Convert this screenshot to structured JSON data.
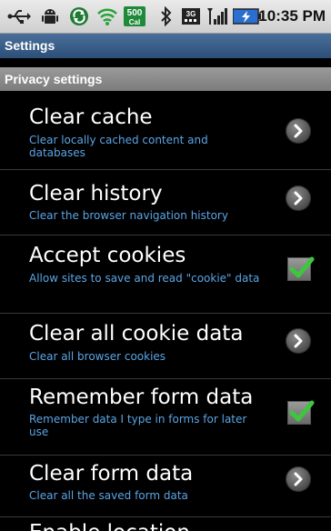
{
  "status_bar": {
    "data_badge": "500",
    "data_badge_sub": "Cal",
    "network_type": "3G",
    "time": "10:35 PM",
    "icons": [
      "usb-icon",
      "android-icon",
      "sync-icon",
      "wifi-icon",
      "calorie-badge-icon",
      "bluetooth-icon",
      "3g-icon",
      "signal-icon",
      "battery-icon"
    ]
  },
  "title_bar": {
    "title": "Settings"
  },
  "section": {
    "title": "Privacy settings"
  },
  "items": [
    {
      "title": "Clear cache",
      "summary": "Clear locally cached content and databases",
      "widget": "chevron"
    },
    {
      "title": "Clear history",
      "summary": "Clear the browser navigation history",
      "widget": "chevron"
    },
    {
      "title": "Accept cookies",
      "summary": "Allow sites to save and read \"cookie\" data",
      "widget": "checkbox",
      "checked": true
    },
    {
      "title": "Clear all cookie data",
      "summary": "Clear all browser cookies",
      "widget": "chevron"
    },
    {
      "title": "Remember form data",
      "summary": "Remember data I type in forms for later use",
      "widget": "checkbox",
      "checked": true
    },
    {
      "title": "Clear form data",
      "summary": "Clear all the saved form data",
      "widget": "chevron"
    },
    {
      "title": "Enable location",
      "summary": "",
      "widget": "none"
    }
  ],
  "colors": {
    "title_bar": "#2c4f78",
    "summary_text": "#5aa5e6",
    "check_green": "#3ec63e"
  }
}
